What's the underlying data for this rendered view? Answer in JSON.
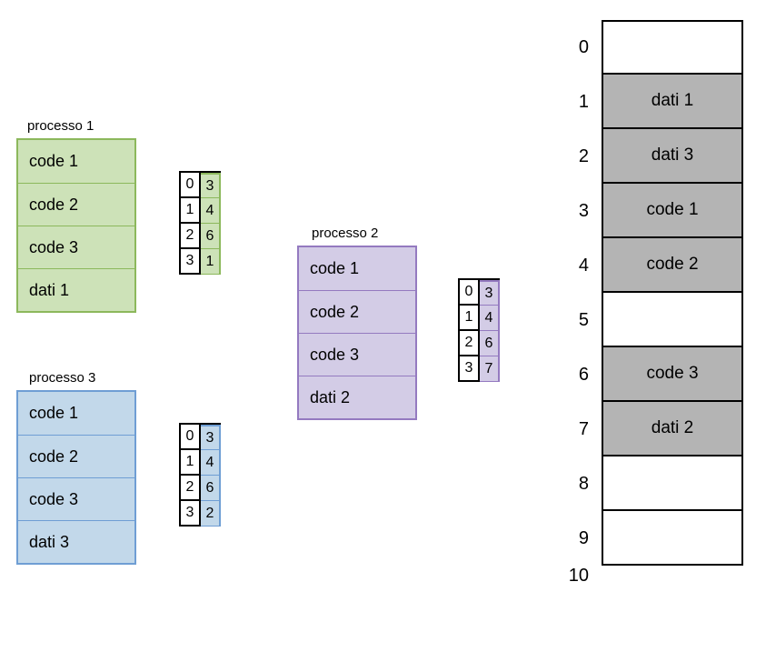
{
  "processes": [
    {
      "label": "processo 1",
      "color": {
        "fill": "#cde2b8",
        "border": "#8cb85c"
      },
      "pages": [
        "code 1",
        "code 2",
        "code 3",
        "dati 1"
      ],
      "page_table": [
        {
          "idx": "0",
          "frame": "3"
        },
        {
          "idx": "1",
          "frame": "4"
        },
        {
          "idx": "2",
          "frame": "6"
        },
        {
          "idx": "3",
          "frame": "1"
        }
      ]
    },
    {
      "label": "processo 2",
      "color": {
        "fill": "#d3cce6",
        "border": "#947ac0"
      },
      "pages": [
        "code 1",
        "code 2",
        "code 3",
        "dati 2"
      ],
      "page_table": [
        {
          "idx": "0",
          "frame": "3"
        },
        {
          "idx": "1",
          "frame": "4"
        },
        {
          "idx": "2",
          "frame": "6"
        },
        {
          "idx": "3",
          "frame": "7"
        }
      ]
    },
    {
      "label": "processo 3",
      "color": {
        "fill": "#c2d8ea",
        "border": "#6f9ed4"
      },
      "pages": [
        "code 1",
        "code 2",
        "code 3",
        "dati 3"
      ],
      "page_table": [
        {
          "idx": "0",
          "frame": "3"
        },
        {
          "idx": "1",
          "frame": "4"
        },
        {
          "idx": "2",
          "frame": "6"
        },
        {
          "idx": "3",
          "frame": "2"
        }
      ]
    }
  ],
  "memory": [
    {
      "n": "0",
      "label": "",
      "filled": false
    },
    {
      "n": "1",
      "label": "dati 1",
      "filled": true
    },
    {
      "n": "2",
      "label": "dati 3",
      "filled": true
    },
    {
      "n": "3",
      "label": "code 1",
      "filled": true
    },
    {
      "n": "4",
      "label": "code 2",
      "filled": true
    },
    {
      "n": "5",
      "label": "",
      "filled": false
    },
    {
      "n": "6",
      "label": "code 3",
      "filled": true
    },
    {
      "n": "7",
      "label": "dati 2",
      "filled": true
    },
    {
      "n": "8",
      "label": "",
      "filled": false
    },
    {
      "n": "9",
      "label": "",
      "filled": false
    }
  ],
  "memory_last_tick": "10"
}
